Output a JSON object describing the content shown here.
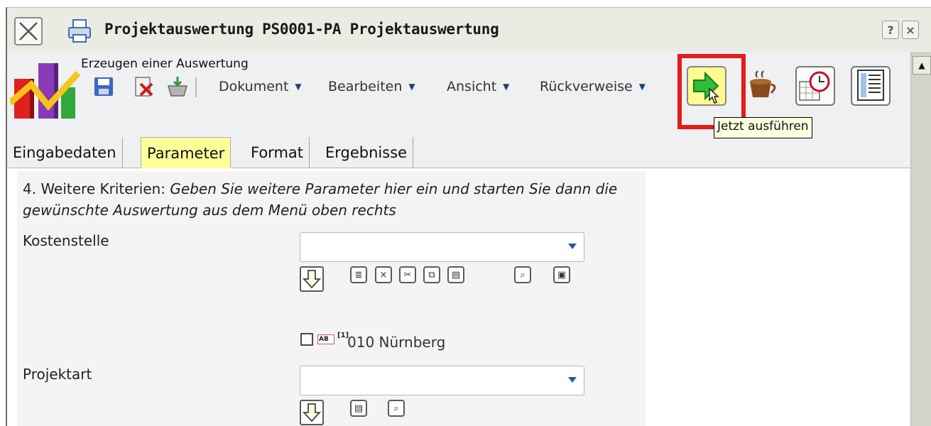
{
  "window": {
    "title": "Projektauswertung PS0001-PA Projektauswertung",
    "help_label": "?",
    "close_label": "×"
  },
  "toolbar": {
    "caption": "Erzeugen einer Auswertung",
    "menus": [
      {
        "label": "Dokument"
      },
      {
        "label": "Bearbeiten"
      },
      {
        "label": "Ansicht"
      },
      {
        "label": "Rückverweise"
      }
    ],
    "menu_arrow": "▼",
    "tooltip": "Jetzt ausführen"
  },
  "tabs": [
    {
      "label": "Eingabedaten",
      "active": false
    },
    {
      "label": "Parameter",
      "active": true
    },
    {
      "label": "Format",
      "active": false
    },
    {
      "label": "Ergebnisse",
      "active": false
    }
  ],
  "form": {
    "instruction_prefix": "4. Weitere Kriterien: ",
    "instruction_italic": "Geben Sie weitere Parameter hier ein und starten Sie dann die gewünschte Auswertung aus dem Menü oben rechts",
    "kostenstelle": {
      "label": "Kostenstelle",
      "value": "",
      "item_marker": "AB",
      "item_ref": "[1]",
      "item_text": "010 Nürnberg",
      "item_checked": false
    },
    "projektart": {
      "label": "Projektart",
      "value": ""
    }
  },
  "colors": {
    "highlight": "#e31b1b",
    "active_tab": "#ffff9a",
    "tooltip_bg": "#ffffe1"
  }
}
